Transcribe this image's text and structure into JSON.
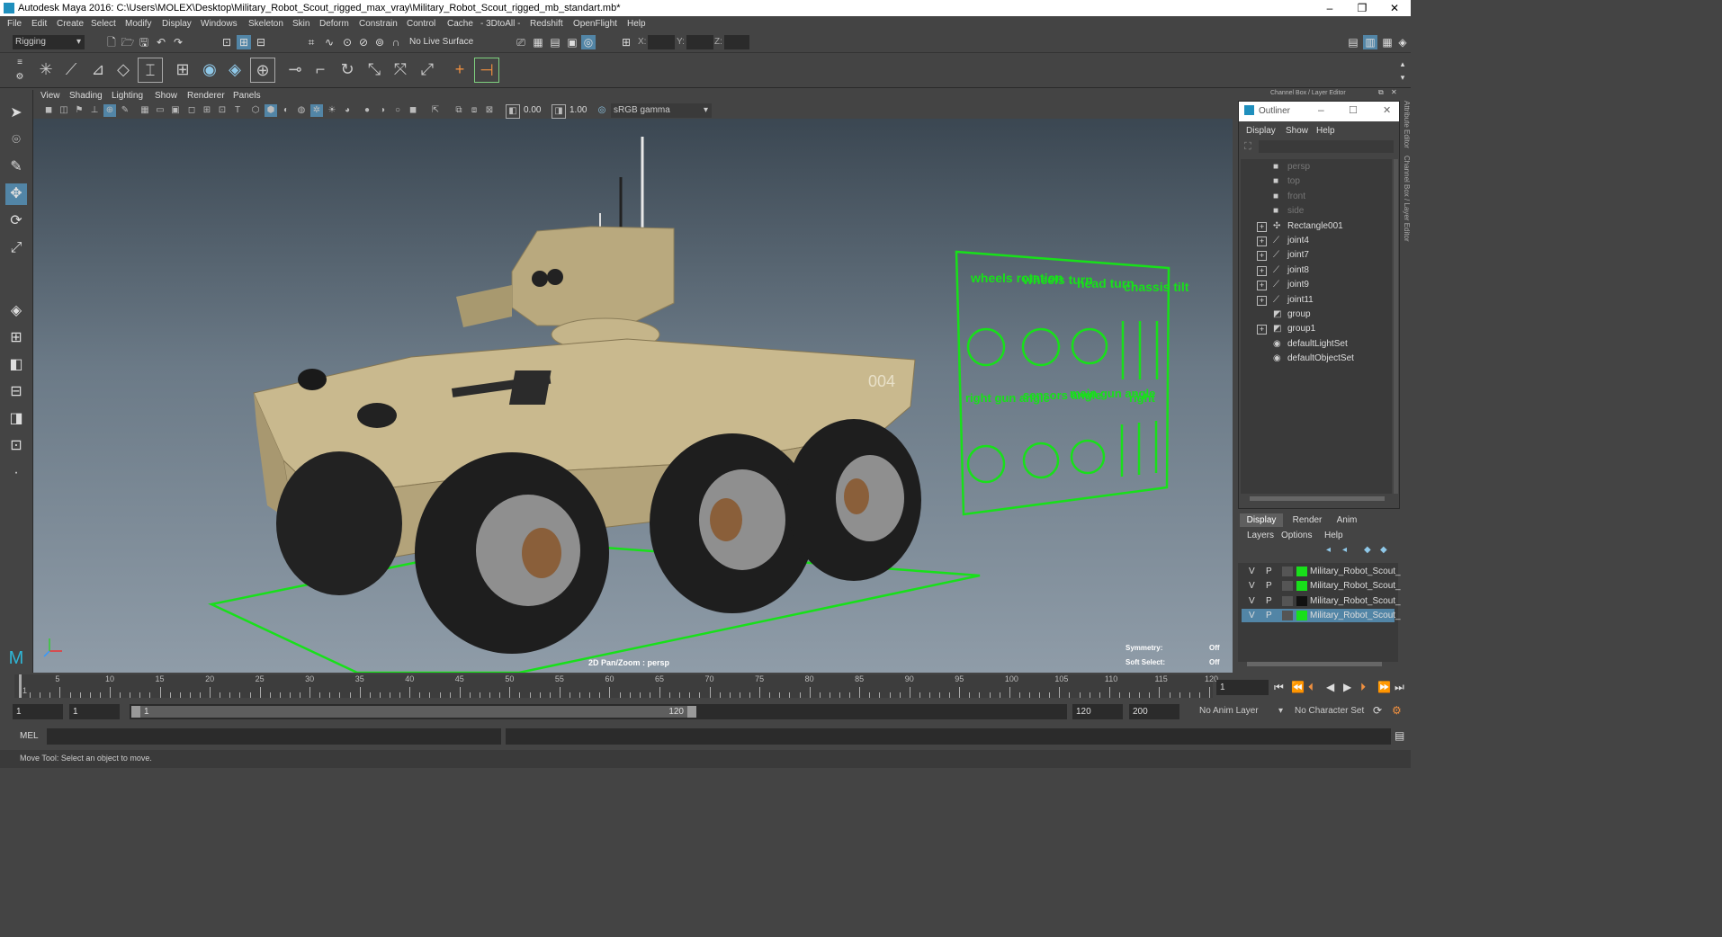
{
  "window": {
    "title": "Autodesk Maya 2016: C:\\Users\\MOLEX\\Desktop\\Military_Robot_Scout_rigged_max_vray\\Military_Robot_Scout_rigged_mb_standart.mb*",
    "minimize": "–",
    "maximize": "❐",
    "close": "✕"
  },
  "menubar": [
    "File",
    "Edit",
    "Create",
    "Select",
    "Modify",
    "Display",
    "Windows",
    "Skeleton",
    "Skin",
    "Deform",
    "Constrain",
    "Control",
    "Cache",
    "- 3DtoAll -",
    "Redshift",
    "OpenFlight",
    "Help"
  ],
  "statusline": {
    "mode": "Rigging",
    "live_surface": "No Live Surface",
    "x_label": "X:",
    "y_label": "Y:",
    "z_label": "Z:"
  },
  "panel_menu": [
    "View",
    "Shading",
    "Lighting",
    "Show",
    "Renderer",
    "Panels"
  ],
  "panel_toolbar": {
    "exposure": "0.00",
    "gamma": "1.00",
    "colorspace": "sRGB gamma"
  },
  "viewport": {
    "camera_label": "2D Pan/Zoom : persp",
    "symmetry_label": "Symmetry:",
    "symmetry_value": "Off",
    "soft_select_label": "Soft Select:",
    "soft_select_value": "Off",
    "hull_number": "004",
    "control_board": {
      "labels": [
        "wheels rotation",
        "wheels turn",
        "head turn",
        "chassis tilt",
        "right gun angle",
        "sensors angle",
        "main gun angle",
        "right"
      ]
    }
  },
  "right_panel": {
    "header": "Channel Box / Layer Editor",
    "side_tabs": [
      "Attribute Editor",
      "Channel Box / Layer Editor"
    ]
  },
  "outliner": {
    "title": "Outliner",
    "menu": [
      "Display",
      "Show",
      "Help"
    ],
    "items": [
      {
        "label": "persp",
        "icon": "camera",
        "dim": true,
        "expand": false
      },
      {
        "label": "top",
        "icon": "camera",
        "dim": true,
        "expand": false
      },
      {
        "label": "front",
        "icon": "camera",
        "dim": true,
        "expand": false
      },
      {
        "label": "side",
        "icon": "camera",
        "dim": true,
        "expand": false
      },
      {
        "label": "Rectangle001",
        "icon": "curve",
        "dim": false,
        "expand": true
      },
      {
        "label": "joint4",
        "icon": "joint",
        "dim": false,
        "expand": true
      },
      {
        "label": "joint7",
        "icon": "joint",
        "dim": false,
        "expand": true
      },
      {
        "label": "joint8",
        "icon": "joint",
        "dim": false,
        "expand": true
      },
      {
        "label": "joint9",
        "icon": "joint",
        "dim": false,
        "expand": true
      },
      {
        "label": "joint11",
        "icon": "joint",
        "dim": false,
        "expand": true
      },
      {
        "label": "group",
        "icon": "group",
        "dim": false,
        "expand": false
      },
      {
        "label": "group1",
        "icon": "group",
        "dim": false,
        "expand": true
      },
      {
        "label": "defaultLightSet",
        "icon": "set",
        "dim": false,
        "expand": false
      },
      {
        "label": "defaultObjectSet",
        "icon": "set",
        "dim": false,
        "expand": false
      }
    ]
  },
  "layer_editor": {
    "tabs": [
      "Display",
      "Render",
      "Anim"
    ],
    "menu": [
      "Layers",
      "Options",
      "Help"
    ],
    "layers": [
      {
        "v": "V",
        "p": "P",
        "color": "#18e01a",
        "name": "Military_Robot_Scout_",
        "selected": false
      },
      {
        "v": "V",
        "p": "P",
        "color": "#18e01a",
        "name": "Military_Robot_Scout_",
        "selected": false
      },
      {
        "v": "V",
        "p": "P",
        "color": "#111111",
        "name": "Military_Robot_Scout_",
        "selected": false
      },
      {
        "v": "V",
        "p": "P",
        "color": "#18e01a",
        "name": "Military_Robot_Scout_",
        "selected": true
      }
    ]
  },
  "timeline": {
    "start": 1,
    "end": 120,
    "labels": [
      "5",
      "10",
      "15",
      "20",
      "25",
      "30",
      "35",
      "40",
      "45",
      "50",
      "55",
      "60",
      "65",
      "70",
      "75",
      "80",
      "85",
      "90",
      "95",
      "100",
      "105",
      "110",
      "115",
      "120"
    ],
    "current_frame": "1",
    "current_marker": "1"
  },
  "range": {
    "start_field": "1",
    "anim_start": "1",
    "slider_start": "1",
    "slider_end": "120",
    "anim_end": "120",
    "end_field": "200",
    "anim_layer": "No Anim Layer",
    "char_set": "No Character Set"
  },
  "command_line": {
    "label": "MEL"
  },
  "help_line": {
    "text": "Move Tool: Select an object to move."
  },
  "colors": {
    "ui_bg": "#444444",
    "highlight": "#5285a6",
    "rig_green": "#18e01a",
    "vehicle_tan": "#c9b98e"
  }
}
